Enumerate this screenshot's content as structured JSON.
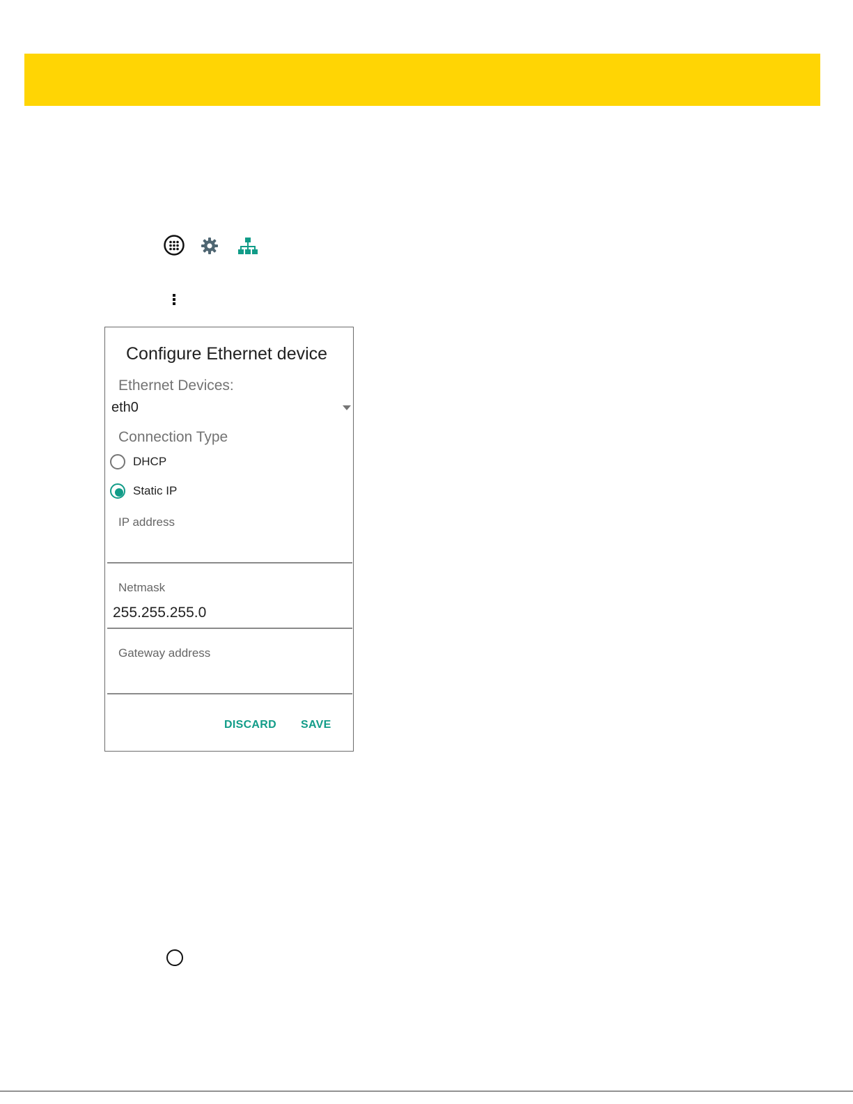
{
  "colors": {
    "header_band": "#ffd504",
    "accent": "#119c88",
    "secondary_text": "#737373"
  },
  "icons": {
    "apps": "apps-grid-icon",
    "settings": "gear-icon",
    "ethernet": "ethernet-network-icon",
    "overflow": "overflow-menu-icon",
    "home": "home-circle-icon"
  },
  "dialog": {
    "title": "Configure Ethernet device",
    "devices_label": "Ethernet Devices:",
    "selected_device": "eth0",
    "connection_type_label": "Connection Type",
    "connection_options": [
      {
        "label": "DHCP",
        "selected": false
      },
      {
        "label": "Static IP",
        "selected": true
      }
    ],
    "fields": {
      "ip_address": {
        "label": "IP address",
        "value": ""
      },
      "netmask": {
        "label": "Netmask",
        "value": "255.255.255.0"
      },
      "gateway": {
        "label": "Gateway address",
        "value": ""
      }
    },
    "discard_label": "DISCARD",
    "save_label": "SAVE"
  }
}
